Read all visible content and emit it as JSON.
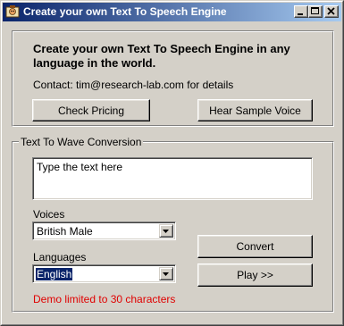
{
  "window": {
    "title": "Create your own Text To Speech Engine",
    "controls": {
      "minimize": "minimize-icon",
      "maximize": "maximize-icon",
      "close": "close-icon"
    }
  },
  "intro": {
    "headline": "Create your own Text To Speech Engine in any language in the world.",
    "contact": "Contact: tim@research-lab.com for details",
    "check_pricing_label": "Check Pricing",
    "hear_sample_label": "Hear Sample Voice"
  },
  "conversion": {
    "group_title": "Text To Wave Conversion",
    "text_value": "Type the text here",
    "voices_label": "Voices",
    "voice_selected": "British Male",
    "languages_label": "Languages",
    "language_selected": "English",
    "convert_label": "Convert",
    "play_label": "Play >>",
    "demo_notice": "Demo limited to 30 characters"
  },
  "colors": {
    "titlebar_start": "#0a246a",
    "titlebar_end": "#a6caf0",
    "face": "#d4d0c8",
    "demo_text": "#e00000"
  }
}
